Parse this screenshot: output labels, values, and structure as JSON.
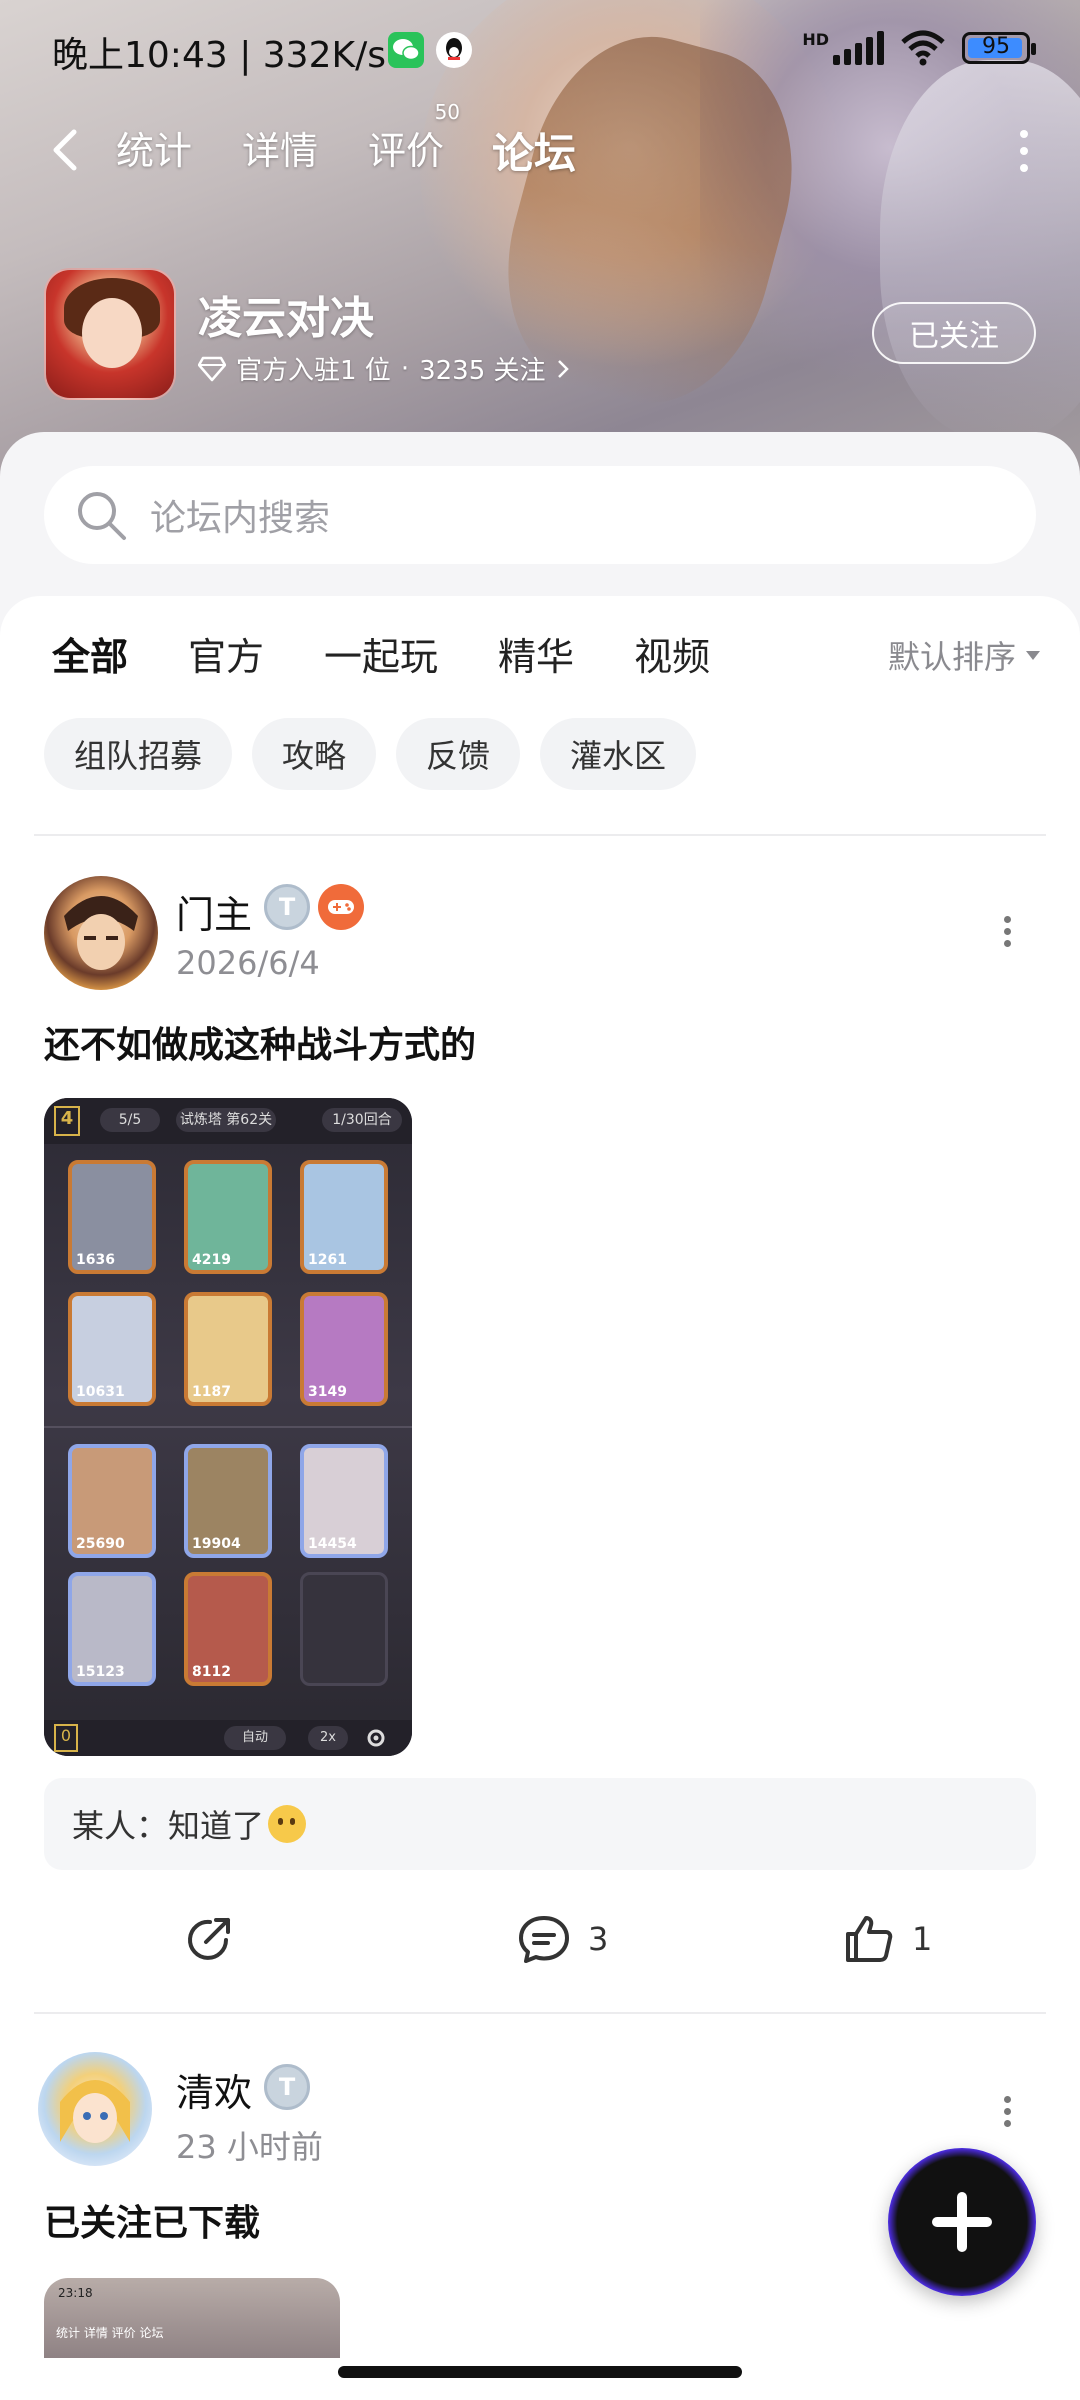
{
  "status_bar": {
    "time": "晚上10:43",
    "speed": "332K/s",
    "battery": "95",
    "hd_label": "HD"
  },
  "top_nav": {
    "tabs": [
      {
        "label": "统计"
      },
      {
        "label": "详情"
      },
      {
        "label": "评价",
        "badge": "50"
      },
      {
        "label": "论坛",
        "active": true
      }
    ]
  },
  "game": {
    "title": "凌云对决",
    "rank": "官方入驻1 位",
    "followers": "3235 关注",
    "follow_button": "已关注"
  },
  "search": {
    "placeholder": "论坛内搜索"
  },
  "category_tabs": [
    {
      "label": "全部",
      "active": true
    },
    {
      "label": "官方"
    },
    {
      "label": "一起玩"
    },
    {
      "label": "精华"
    },
    {
      "label": "视频"
    }
  ],
  "sort_label": "默认排序",
  "chips": [
    "组队招募",
    "攻略",
    "反馈",
    "灌水区"
  ],
  "posts": [
    {
      "author": "门主",
      "time": "2026/6/4",
      "text": "还不如做成这种战斗方式的",
      "screenshot": {
        "level": "4",
        "wave": "5/5",
        "stage": "试炼塔 第62关",
        "round": "1/30回合",
        "energy": "0",
        "auto": "自动",
        "speed": "2x",
        "hp_values": [
          "1636",
          "4219",
          "1261",
          "10631",
          "1187",
          "3149",
          "25690",
          "19904",
          "14454",
          "15123",
          "8112"
        ]
      },
      "comment_author": "某人：",
      "comment_text": "知道了",
      "comments": "3",
      "likes": "1"
    },
    {
      "author": "清欢",
      "time": "23 小时前",
      "text": "已关注已下载",
      "thumb_time": "23:18",
      "thumb_tabs": "统计   详情   评价   论坛"
    }
  ],
  "colors": {
    "accent": "#2ed3c4",
    "badge_orange": "#f06b3a"
  }
}
